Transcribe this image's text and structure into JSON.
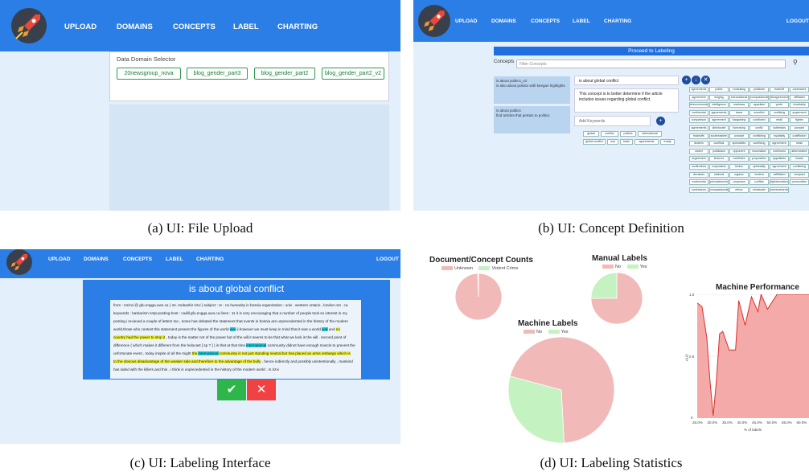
{
  "nav": {
    "upload": "UPLOAD",
    "domains": "DOMAINS",
    "concepts": "CONCEPTS",
    "label": "LABEL",
    "charting": "CHARTING",
    "logout": "LOGOUT"
  },
  "colors": {
    "nav": "#2a7ee6",
    "bg": "#e3effa",
    "accept": "#2fb64b",
    "reject": "#f04242",
    "pie_red": "#f2b9b9",
    "pie_green": "#c5f2c1"
  },
  "panel_a": {
    "selector_title": "Data Domain Selector",
    "domains": [
      "20newsgroup_nova",
      "blog_gender_part3",
      "blog_gender_part2",
      "blog_gender_part2_v2"
    ],
    "caption": "(a) UI: File Upload"
  },
  "panel_b": {
    "proceed": "Proceed to Labeling",
    "concepts_label": "Concepts",
    "filter_placeholder": "Filter Concepts",
    "card1_title": "is about politics_v3",
    "card1_sub": "is also about politics with keegan highlights",
    "card2_title": "is about politics",
    "card2_sub": "find articles that pertain to politics",
    "concept_name": "is about global conflict",
    "concept_desc": "This concept is to better determine if the article includes issues regarding global conflict.",
    "add_keywords": "Add Keywords",
    "keywords": [
      "global",
      "conflict",
      "politics",
      "international",
      "global conflict",
      "war",
      "trade",
      "agreements",
      "treaty"
    ],
    "suggestions": [
      "agreements",
      "politic",
      "consulting",
      "politician",
      "tradeoff",
      "contravent",
      "agreement",
      "singing",
      "extranational",
      "compassionate",
      "disagreement",
      "affiliated",
      "telecommunications",
      "intelligence",
      "madness",
      "appellant",
      "youth",
      "charitably",
      "continental",
      "agreements",
      "taxes",
      "econfiict",
      "conflictig",
      "argeement",
      "comparison",
      "agreement",
      "bargaining",
      "conflicted",
      "retail",
      "fighter",
      "agreements",
      "directorate",
      "borrowing",
      "confic",
      "outbreaks",
      "pursant",
      "tradeoffs",
      "southeastern",
      "concept",
      "confiicting",
      "equitably",
      "coaffliction",
      "dealers",
      "conflicts",
      "specialties",
      "conflicing",
      "agreement",
      "retail",
      "career",
      "politicians",
      "opponent",
      "insomation",
      "northwest",
      "abbreviative",
      "argeement",
      "lectures",
      "conflicted",
      "proposition",
      "appellants",
      "heads",
      "confirmines",
      "corporation",
      "bicker",
      "spirituality",
      "agreement",
      "conflicting",
      "devalues",
      "national",
      "organic",
      "modem",
      "caffiliated",
      "compact",
      "continental",
      "principlesreckoning",
      "coopness",
      "conflics",
      "dgiinternational",
      "premonition",
      "contrivance",
      "compassionately",
      "ethics",
      "wholesale",
      "misrepresentation"
    ],
    "caption": "(b) UI: Concept Definition"
  },
  "panel_c": {
    "title": "is about global conflict",
    "lines": [
      [
        [
          "from : mrizvi @ gfu.engga.uwo.ca ( mr. mubashir rizvi ) subject : re : no humanity in bosnia organization : univ . western ontario , london ont . ca",
          ""
        ]
      ],
      [
        [
          "keywords : barbarism nntp-posting-host : cadill.gfu.engga.uwo.ca lines : 11 it is very encouraging that a number of people took so interest in my",
          ""
        ]
      ],
      [
        [
          "posting.i recieved a couple of letters too , some has debated the statement that events in bosnia are unprecedented in the history of the modern",
          ""
        ]
      ],
      [
        [
          "world.those who contest this statement present the figures of the world ",
          ""
        ],
        [
          "war",
          "c"
        ],
        [
          " ii.however we must keep in mind that it was a world ",
          ""
        ],
        [
          "war",
          "c"
        ],
        [
          " and ",
          ""
        ],
        [
          "no",
          "y"
        ]
      ],
      [
        [
          "country had the power to stop it",
          "y"
        ],
        [
          " , today is the matter not of the power but of the will.it seems to be that what we lack is the will . second point of",
          ""
        ]
      ],
      [
        [
          "difference ( which makes it different from the holocast [ sp ? ] ) is that at that time ",
          ""
        ],
        [
          "international",
          "c"
        ],
        [
          " community didnot have enough muscle to prevent the",
          ""
        ]
      ],
      [
        [
          "unfortunate event , today inspite of all the might ",
          ""
        ],
        [
          "the ",
          "y"
        ],
        [
          "international",
          "c"
        ],
        [
          " community is not just standing neutral but has placed an arms embargo which is",
          "y"
        ]
      ],
      [
        [
          "to the obvious disadvantage of the weaker side and therefore to the advantage of the bully",
          "y"
        ],
        [
          " , hence indirectly and possibly unintentionally , mankind",
          ""
        ]
      ],
      [
        [
          "has sided with the killers.and this , i think is unprecedented in the history of the modern world . m.rizvi",
          ""
        ]
      ]
    ],
    "accept_icon": "✔",
    "reject_icon": "✕",
    "caption": "(c) UI: Labeling Interface"
  },
  "panel_d": {
    "counts_title": "Document/Concept Counts",
    "counts_legend": [
      "Unknown",
      "Violent Crime"
    ],
    "manual_title": "Manual Labels",
    "manual_legend": [
      "No",
      "Yes"
    ],
    "machine_title": "Machine Labels",
    "machine_legend": [
      "No",
      "Yes"
    ],
    "perf_title": "Machine Performance",
    "perf_ylabel": "AUC",
    "perf_xlabel": "% of labels",
    "perf_yticks": [
      "1.0",
      "0.5",
      "0"
    ],
    "perf_xticks": [
      "25.0%",
      "30.0%",
      "35.0%",
      "40.0%",
      "45.0%",
      "50.0%",
      "55.0%",
      "60.0%"
    ],
    "caption": "(d) UI: Labeling Statistics"
  },
  "chart_data": [
    {
      "type": "pie",
      "title": "Document/Concept Counts",
      "categories": [
        "Unknown",
        "Violent Crime"
      ],
      "values": [
        99.5,
        0.5
      ]
    },
    {
      "type": "pie",
      "title": "Manual Labels",
      "categories": [
        "No",
        "Yes"
      ],
      "values": [
        75,
        25
      ]
    },
    {
      "type": "pie",
      "title": "Machine Labels",
      "categories": [
        "No",
        "Yes"
      ],
      "values": [
        70,
        30
      ]
    },
    {
      "type": "area",
      "title": "Machine Performance",
      "xlabel": "% of labels",
      "ylabel": "AUC",
      "ylim": [
        0,
        1
      ],
      "x": [
        25,
        26.5,
        28,
        29,
        30,
        31,
        32,
        33,
        35,
        37,
        38,
        40,
        42,
        44,
        45,
        47,
        50,
        55,
        60
      ],
      "values": [
        0.93,
        0.9,
        0.65,
        0.3,
        0.02,
        0.3,
        0.68,
        0.7,
        0.55,
        0.55,
        0.95,
        0.75,
        0.98,
        0.86,
        1.0,
        0.88,
        1.0,
        1.0,
        1.0
      ]
    }
  ]
}
